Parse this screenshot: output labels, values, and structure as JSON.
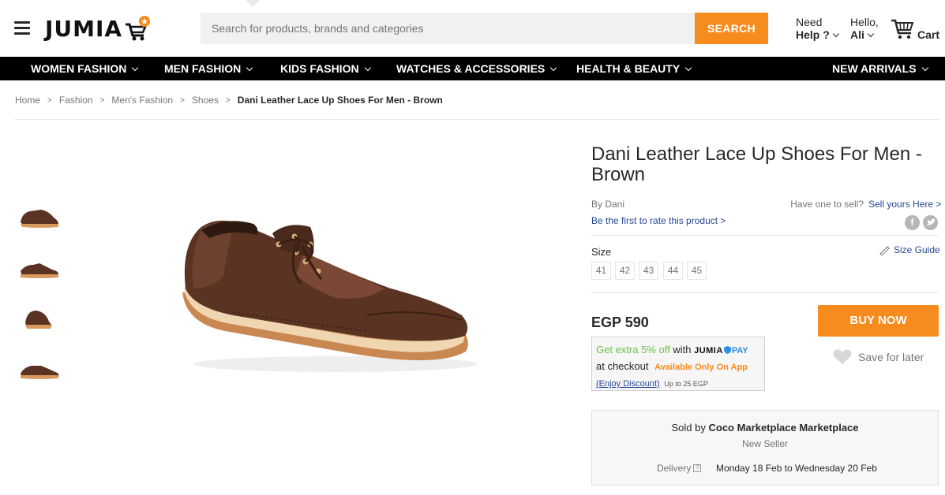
{
  "header": {
    "logo_text": "JUMIA",
    "search_placeholder": "Search for products, brands and categories",
    "search_button": "SEARCH",
    "help_top": "Need",
    "help_bottom": "Help ?",
    "account_top": "Hello,",
    "account_bottom": "Ali",
    "cart_label": "Cart"
  },
  "nav": {
    "items": [
      {
        "label": "WOMEN FASHION"
      },
      {
        "label": "MEN FASHION"
      },
      {
        "label": "KIDS FASHION"
      },
      {
        "label": "WATCHES & ACCESSORIES"
      },
      {
        "label": "HEALTH & BEAUTY"
      },
      {
        "label": "NEW ARRIVALS"
      }
    ]
  },
  "breadcrumb": {
    "items": [
      "Home",
      "Fashion",
      "Men's Fashion",
      "Shoes"
    ],
    "current": "Dani Leather Lace Up Shoes For Men - Brown",
    "separator": ">"
  },
  "product": {
    "title": "Dani Leather Lace Up Shoes For Men - Brown",
    "brand": "By Dani",
    "rate_link": "Be the first to rate this product >",
    "sell_question": "Have one to sell?",
    "sell_link": "Sell yours Here >",
    "social_f": "f",
    "size_label": "Size",
    "size_guide": "Size Guide",
    "sizes": [
      "41",
      "42",
      "43",
      "44",
      "45"
    ],
    "price": "EGP 590",
    "buy_now": "BUY NOW",
    "save_for_later": "Save for later"
  },
  "promo": {
    "line1_green": "Get extra 5% off",
    "line1_with": "with",
    "brand_jumia": "JUMIA",
    "brand_pay": "PAY",
    "line2": "at checkout",
    "line2_orange": "Available Only On App",
    "link": "(Enjoy Discount)",
    "note": "Up to 25 EGP"
  },
  "seller": {
    "sold_by_prefix": "Sold by",
    "seller_name": "Coco Marketplace Marketplace",
    "status": "New Seller",
    "delivery_label": "Delivery",
    "delivery_help": "?",
    "delivery_dates": "Monday 18 Feb to Wednesday 20 Feb"
  },
  "colors": {
    "accent": "#f68b1e",
    "nav_bg": "#000000",
    "link": "#264996",
    "shoe_brown": "#5a3322",
    "sole": "#d89a5c"
  }
}
